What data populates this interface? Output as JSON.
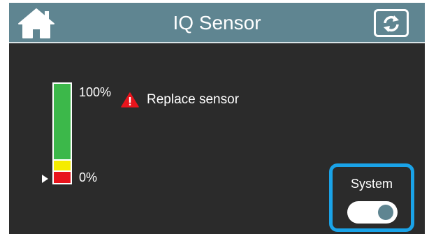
{
  "header": {
    "title": "IQ Sensor",
    "home_icon": "home-icon",
    "refresh_icon": "refresh-icon"
  },
  "sensor": {
    "max_label": "100%",
    "min_label": "0%",
    "level_fraction": 0.0,
    "warning_icon": "warning-triangle-icon",
    "warning_text": "Replace sensor"
  },
  "system": {
    "label": "System",
    "toggle_state": "on"
  },
  "colors": {
    "header_bg": "#5f8591",
    "screen_bg": "#2b2b2b",
    "level_green": "#3cb84a",
    "level_yellow": "#f5ec00",
    "level_red": "#e8141c",
    "highlight": "#1aa3e8",
    "warning": "#e8141c"
  }
}
